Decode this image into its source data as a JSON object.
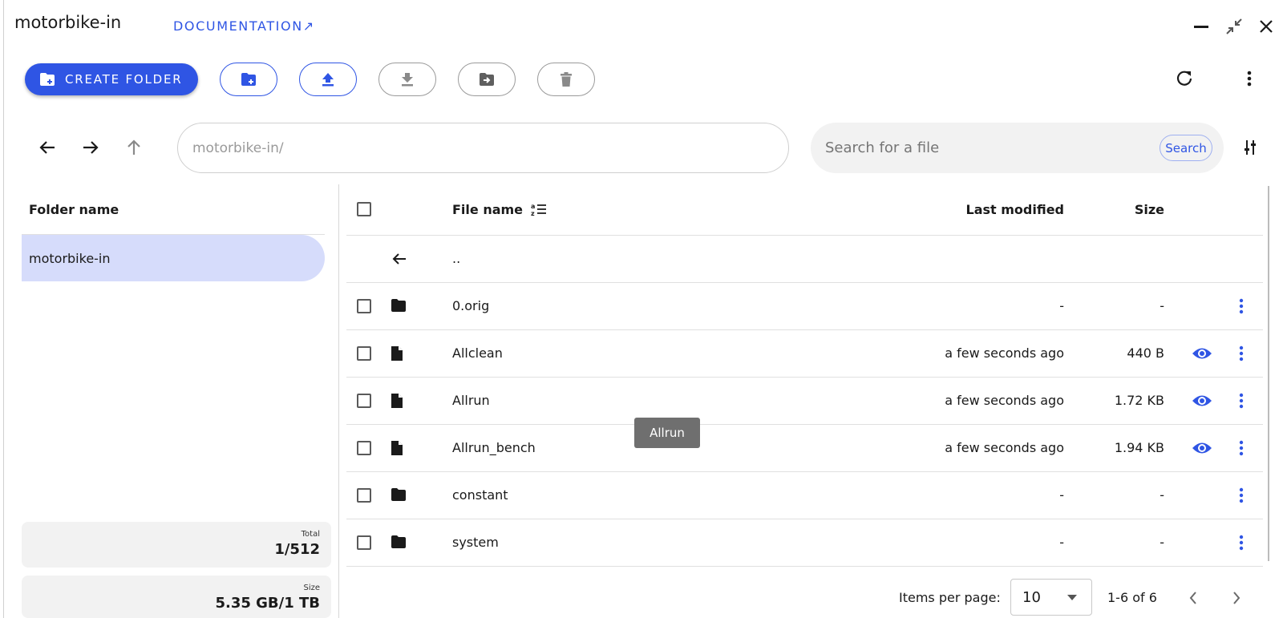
{
  "header": {
    "title": "motorbike-in",
    "documentation_label": "DOCUMENTATION",
    "documentation_arrow": "↗"
  },
  "toolbar": {
    "create_folder_label": "CREATE FOLDER"
  },
  "navigation": {
    "path_value": "motorbike-in/"
  },
  "search": {
    "placeholder": "Search for a file",
    "button_label": "Search"
  },
  "sidebar": {
    "header": "Folder name",
    "folders": [
      {
        "label": "motorbike-in",
        "selected": true
      }
    ],
    "stats": {
      "total_label": "Total",
      "total_value": "1/512",
      "size_label": "Size",
      "size_value": "5.35 GB/1 TB"
    }
  },
  "table": {
    "columns": {
      "name": "File name",
      "modified": "Last modified",
      "size": "Size"
    },
    "parent_row": "..",
    "rows": [
      {
        "name": "0.orig",
        "type": "folder",
        "modified": "-",
        "size": "-",
        "previewable": false
      },
      {
        "name": "Allclean",
        "type": "file",
        "modified": "a few seconds ago",
        "size": "440 B",
        "previewable": true
      },
      {
        "name": "Allrun",
        "type": "file",
        "modified": "a few seconds ago",
        "size": "1.72 KB",
        "previewable": true
      },
      {
        "name": "Allrun_bench",
        "type": "file",
        "modified": "a few seconds ago",
        "size": "1.94 KB",
        "previewable": true
      },
      {
        "name": "constant",
        "type": "folder",
        "modified": "-",
        "size": "-",
        "previewable": false
      },
      {
        "name": "system",
        "type": "folder",
        "modified": "-",
        "size": "-",
        "previewable": false
      }
    ],
    "tooltip": "Allrun"
  },
  "pagination": {
    "items_per_page_label": "Items per page:",
    "items_per_page_value": "10",
    "range_label": "1-6 of 6"
  },
  "colors": {
    "accent": "#2f55e4",
    "selected_folder_bg": "#d6dcfb"
  }
}
